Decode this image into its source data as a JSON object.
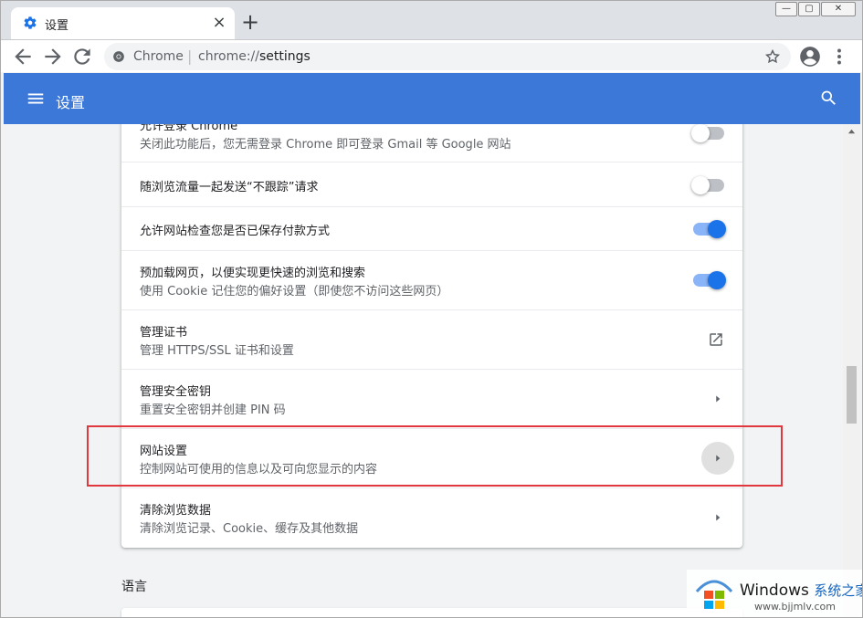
{
  "tab": {
    "title": "设置",
    "close": "×",
    "new_tab": "+"
  },
  "window_controls": {
    "minimize": "—",
    "maximize": "▢",
    "close": "✕"
  },
  "toolbar": {
    "site_label": "Chrome",
    "separator": "|",
    "url_scheme": "chrome://",
    "url_host": "settings"
  },
  "appbar": {
    "title": "设置",
    "accent_color": "#3c78d8"
  },
  "settings_rows": [
    {
      "title": "允许登录 Chrome",
      "subtitle": "关闭此功能后，您无需登录 Chrome 即可登录 Gmail 等 Google 网站",
      "control": "toggle",
      "state": "off"
    },
    {
      "title": "随浏览流量一起发送“不跟踪”请求",
      "control": "toggle",
      "state": "off"
    },
    {
      "title": "允许网站检查您是否已保存付款方式",
      "control": "toggle",
      "state": "on"
    },
    {
      "title": "预加载网页，以便实现更快速的浏览和搜索",
      "subtitle": "使用 Cookie 记住您的偏好设置（即使您不访问这些网页）",
      "control": "toggle",
      "state": "on"
    },
    {
      "title": "管理证书",
      "subtitle": "管理 HTTPS/SSL 证书和设置",
      "control": "external-link"
    },
    {
      "title": "管理安全密钥",
      "subtitle": "重置安全密钥并创建 PIN 码",
      "control": "arrow"
    },
    {
      "title": "网站设置",
      "subtitle": "控制网站可使用的信息以及可向您显示的内容",
      "control": "arrow",
      "highlighted": true
    },
    {
      "title": "清除浏览数据",
      "subtitle": "清除浏览记录、Cookie、缓存及其他数据",
      "control": "arrow"
    }
  ],
  "section": {
    "language_title": "语言"
  },
  "watermark": {
    "brand": "Windows",
    "brand_cn": "系统之家",
    "url": "www.bjjmlv.com"
  },
  "colors": {
    "toggle_on": "#1a73e8",
    "highlight_border": "#e0383e"
  }
}
